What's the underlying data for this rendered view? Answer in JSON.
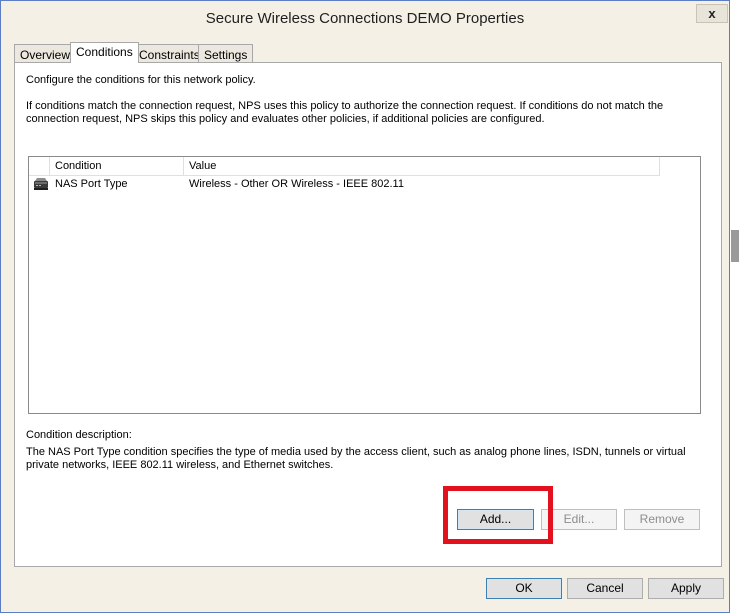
{
  "window": {
    "title": "Secure Wireless Connections DEMO Properties",
    "close_label": "x"
  },
  "tabs": [
    {
      "label": "Overview"
    },
    {
      "label": "Conditions"
    },
    {
      "label": "Constraints"
    },
    {
      "label": "Settings"
    }
  ],
  "active_tab": "Conditions",
  "panel": {
    "intro": "Configure the conditions for this network policy.",
    "explanation_line1": "If conditions match the connection request, NPS uses this policy to authorize the connection request. If conditions do not match the",
    "explanation_line2": "connection request, NPS skips this policy and evaluates other policies, if additional policies are configured."
  },
  "conditions_table": {
    "columns": [
      "Condition",
      "Value"
    ],
    "rows": [
      {
        "icon": "network-device-icon",
        "condition": "NAS Port Type",
        "value": "Wireless - Other OR Wireless - IEEE 802.11"
      }
    ]
  },
  "description": {
    "label": "Condition description:",
    "line1": "The NAS Port Type condition specifies the type of media used by the access client, such as analog phone lines, ISDN, tunnels or virtual",
    "line2": "private networks, IEEE 802.11 wireless, and Ethernet switches."
  },
  "actions": {
    "add": "Add...",
    "edit": "Edit...",
    "remove": "Remove"
  },
  "footer": {
    "ok": "OK",
    "cancel": "Cancel",
    "apply": "Apply"
  },
  "colors": {
    "highlight": "#e3101e",
    "window_frame": "#5c7cc4"
  }
}
